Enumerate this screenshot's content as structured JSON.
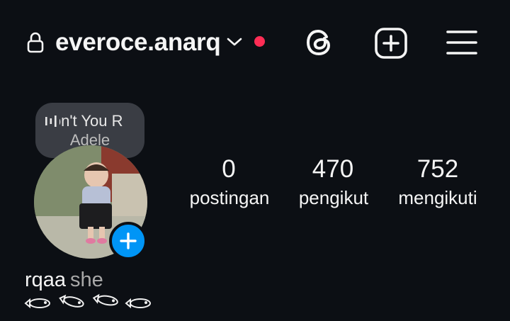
{
  "header": {
    "username": "everoce.anarq",
    "icons": [
      "lock-icon",
      "chevron-down-icon",
      "notification-dot",
      "threads-icon",
      "create-plus-icon",
      "menu-icon"
    ],
    "notification_dot_color": "#ff2d55"
  },
  "note": {
    "song_title": "Don't You R",
    "artist": "Adele",
    "icon": "audio-bars-icon"
  },
  "profile": {
    "add_story_icon": "plus-icon",
    "accent_color": "#0095f6"
  },
  "stats": {
    "posts_count": "0",
    "posts_label": "postingan",
    "followers_count": "470",
    "followers_label": "pengikut",
    "following_count": "752",
    "following_label": "mengikuti"
  },
  "bio": {
    "name": "rqaa",
    "pronouns": "she",
    "emoji_row": "fish-icon x4"
  }
}
